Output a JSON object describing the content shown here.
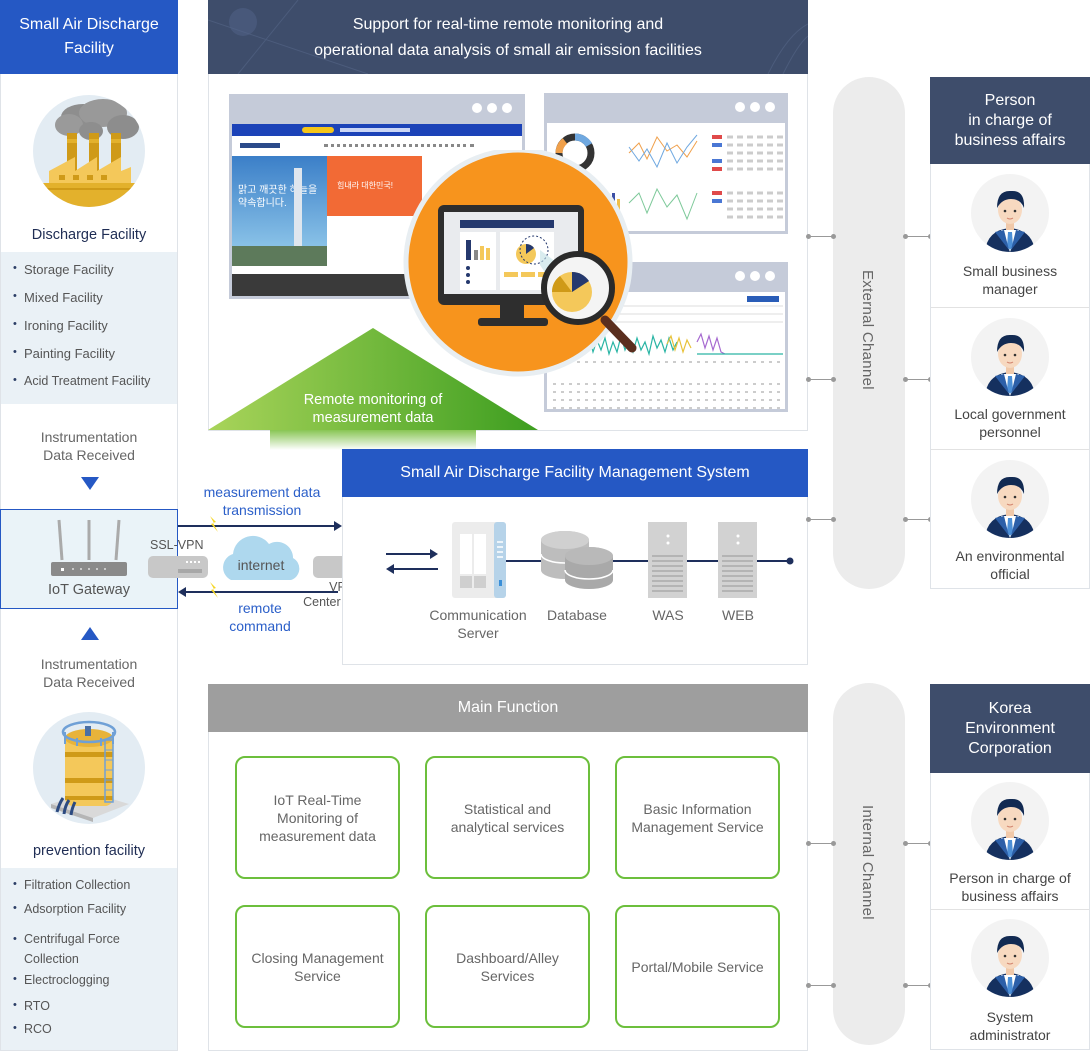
{
  "left": {
    "header": "Small Air Discharge Facility",
    "discharge": {
      "title": "Discharge Facility",
      "icon": "factory-icon",
      "items": [
        "Storage Facility",
        "Mixed Facility",
        "Ironing Facility",
        "Painting Facility",
        "Acid Treatment Facility"
      ]
    },
    "instr_top": "Instrumentation Data Received",
    "gateway_label": "IoT Gateway",
    "instr_bottom": "Instrumentation Data Received",
    "prevention": {
      "title": "prevention facility",
      "icon": "storage-tank-icon",
      "items": [
        "Filtration Collection",
        "Adsorption Facility",
        "Centrifugal Force Collection",
        "Electroclogging",
        "RTO",
        "RCO"
      ]
    }
  },
  "monitoring": {
    "header": "Support for real-time remote monitoring and operational data analysis of small air emission facilities",
    "header_line1": "Support for real-time remote monitoring and",
    "header_line2": "operational data analysis of small air emission facilities",
    "arrow_label_line1": "Remote monitoring of",
    "arrow_label_line2": "measurement data",
    "web_banner_text": "맑고 깨끗한 하늘을 약속합니다.",
    "web_promo_text": "힘내라 대한민국!"
  },
  "network": {
    "ssl_vpn": "SSL-VPN",
    "internet": "internet",
    "vpn_center_line1": "VPN",
    "vpn_center_line2": "Center Server",
    "upload_line1": "measurement data",
    "upload_line2": "transmission",
    "command_line1": "remote",
    "command_line2": "command"
  },
  "system": {
    "header": "Small Air Discharge Facility Management System",
    "servers": [
      {
        "line1": "Communication",
        "line2": "Server",
        "icon": "communication-server-icon"
      },
      {
        "line1": "Database",
        "line2": "",
        "icon": "database-icon"
      },
      {
        "line1": "WAS",
        "line2": "",
        "icon": "was-server-icon"
      },
      {
        "line1": "WEB",
        "line2": "",
        "icon": "web-server-icon"
      }
    ]
  },
  "main_function": {
    "header": "Main Function",
    "cards": [
      "IoT Real-Time Monitoring of measurement data",
      "Statistical and analytical services",
      "Basic Information Management Service",
      "Closing Management Service",
      "Dashboard/Alley Services",
      "Portal/Mobile Service"
    ]
  },
  "channels": {
    "external": "External Channel",
    "internal": "Internal Channel"
  },
  "persons_business": {
    "header_line1": "Person",
    "header_line2": "in charge of",
    "header_line3": "business affairs",
    "people": [
      {
        "line1": "Small business",
        "line2": "manager"
      },
      {
        "line1": "Local government",
        "line2": "personnel"
      },
      {
        "line1": "An environmental",
        "line2": "official"
      }
    ]
  },
  "persons_corp": {
    "header_line1": "Korea",
    "header_line2": "Environment",
    "header_line3": "Corporation",
    "people": [
      {
        "line1": "Person in charge of",
        "line2": "business affairs"
      },
      {
        "line1": "System",
        "line2": "administrator"
      }
    ]
  },
  "colors": {
    "blue_header": "#2558c4",
    "navy_header": "#3e4d6b",
    "gray_header": "#9e9e9e",
    "green_accent": "#6cbf3c",
    "orange_accent": "#f7941d",
    "link_blue": "#2b5fc9"
  }
}
